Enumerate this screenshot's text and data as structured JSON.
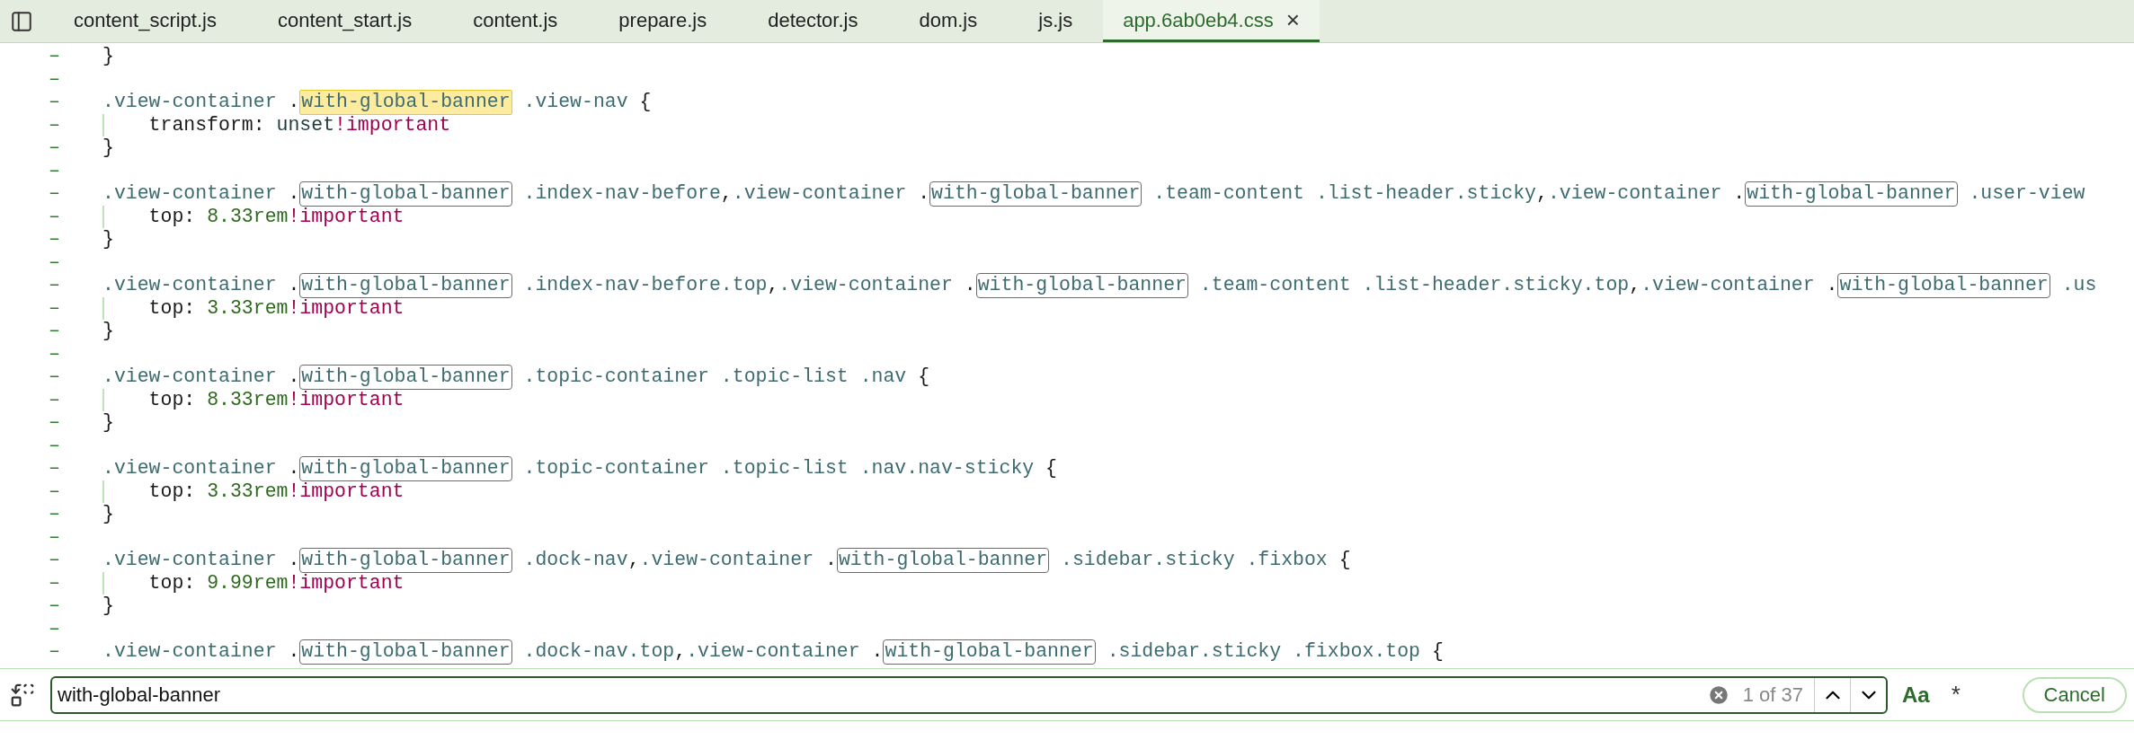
{
  "tabs": [
    {
      "label": "content_script.js",
      "selected": false
    },
    {
      "label": "content_start.js",
      "selected": false
    },
    {
      "label": "content.js",
      "selected": false
    },
    {
      "label": "prepare.js",
      "selected": false
    },
    {
      "label": "detector.js",
      "selected": false
    },
    {
      "label": "dom.js",
      "selected": false
    },
    {
      "label": "js.js",
      "selected": false
    },
    {
      "label": "app.6ab0eb4.css",
      "selected": true,
      "close": "×"
    }
  ],
  "code_lines": [
    {
      "kind": "code",
      "marker": "–",
      "tokens": [
        {
          "text": "}",
          "kind": "punct"
        }
      ]
    },
    {
      "kind": "code",
      "marker": "–"
    },
    {
      "kind": "code",
      "marker": "–",
      "tokens": [
        {
          "text": ".view-container ",
          "kind": "sel"
        },
        {
          "text": ".",
          "kind": "punct"
        },
        {
          "text": "with-global-banner",
          "kind": "current"
        },
        {
          "text": " .view-nav ",
          "kind": "sel"
        },
        {
          "text": "{",
          "kind": "punct"
        }
      ]
    },
    {
      "kind": "declaration",
      "marker": "–",
      "tokens": [
        {
          "text": "    transform: ",
          "kind": "prop"
        },
        {
          "text": "unset",
          "kind": "value"
        },
        {
          "text": "!important",
          "kind": "kw"
        }
      ]
    },
    {
      "kind": "code",
      "marker": "–",
      "tokens": [
        {
          "text": "}",
          "kind": "punct"
        }
      ]
    },
    {
      "kind": "code",
      "marker": "–"
    },
    {
      "kind": "code",
      "marker": "–",
      "tokens": [
        {
          "text": ".view-container ",
          "kind": "sel"
        },
        {
          "text": ".",
          "kind": "punct"
        },
        {
          "text": "with-global-banner",
          "kind": "match"
        },
        {
          "text": " .index-nav-before",
          "kind": "sel"
        },
        {
          "text": ",",
          "kind": "punct"
        },
        {
          "text": ".view-container ",
          "kind": "sel"
        },
        {
          "text": ".",
          "kind": "punct"
        },
        {
          "text": "with-global-banner",
          "kind": "match"
        },
        {
          "text": " .team-content .list-header.sticky",
          "kind": "sel"
        },
        {
          "text": ",",
          "kind": "punct"
        },
        {
          "text": ".view-container ",
          "kind": "sel"
        },
        {
          "text": ".",
          "kind": "punct"
        },
        {
          "text": "with-global-banner",
          "kind": "match"
        },
        {
          "text": " .user-view",
          "kind": "sel"
        }
      ]
    },
    {
      "kind": "declaration",
      "marker": "–",
      "tokens": [
        {
          "text": "    top: ",
          "kind": "prop"
        },
        {
          "text": "8.33rem",
          "kind": "num"
        },
        {
          "text": "!important",
          "kind": "kw"
        }
      ]
    },
    {
      "kind": "code",
      "marker": "–",
      "tokens": [
        {
          "text": "}",
          "kind": "punct"
        }
      ]
    },
    {
      "kind": "code",
      "marker": "–"
    },
    {
      "kind": "code",
      "marker": "–",
      "tokens": [
        {
          "text": ".view-container ",
          "kind": "sel"
        },
        {
          "text": ".",
          "kind": "punct"
        },
        {
          "text": "with-global-banner",
          "kind": "match"
        },
        {
          "text": " .index-nav-before.top",
          "kind": "sel"
        },
        {
          "text": ",",
          "kind": "punct"
        },
        {
          "text": ".view-container ",
          "kind": "sel"
        },
        {
          "text": ".",
          "kind": "punct"
        },
        {
          "text": "with-global-banner",
          "kind": "match"
        },
        {
          "text": " .team-content .list-header.sticky.top",
          "kind": "sel"
        },
        {
          "text": ",",
          "kind": "punct"
        },
        {
          "text": ".view-container ",
          "kind": "sel"
        },
        {
          "text": ".",
          "kind": "punct"
        },
        {
          "text": "with-global-banner",
          "kind": "match"
        },
        {
          "text": " .us",
          "kind": "sel"
        }
      ]
    },
    {
      "kind": "declaration",
      "marker": "–",
      "tokens": [
        {
          "text": "    top: ",
          "kind": "prop"
        },
        {
          "text": "3.33rem",
          "kind": "num"
        },
        {
          "text": "!important",
          "kind": "kw"
        }
      ]
    },
    {
      "kind": "code",
      "marker": "–",
      "tokens": [
        {
          "text": "}",
          "kind": "punct"
        }
      ]
    },
    {
      "kind": "code",
      "marker": "–"
    },
    {
      "kind": "code",
      "marker": "–",
      "tokens": [
        {
          "text": ".view-container ",
          "kind": "sel"
        },
        {
          "text": ".",
          "kind": "punct"
        },
        {
          "text": "with-global-banner",
          "kind": "match"
        },
        {
          "text": " .topic-container .topic-list .nav ",
          "kind": "sel"
        },
        {
          "text": "{",
          "kind": "punct"
        }
      ]
    },
    {
      "kind": "declaration",
      "marker": "–",
      "tokens": [
        {
          "text": "    top: ",
          "kind": "prop"
        },
        {
          "text": "8.33rem",
          "kind": "num"
        },
        {
          "text": "!important",
          "kind": "kw"
        }
      ]
    },
    {
      "kind": "code",
      "marker": "–",
      "tokens": [
        {
          "text": "}",
          "kind": "punct"
        }
      ]
    },
    {
      "kind": "code",
      "marker": "–"
    },
    {
      "kind": "code",
      "marker": "–",
      "tokens": [
        {
          "text": ".view-container ",
          "kind": "sel"
        },
        {
          "text": ".",
          "kind": "punct"
        },
        {
          "text": "with-global-banner",
          "kind": "match"
        },
        {
          "text": " .topic-container .topic-list .nav.nav-sticky ",
          "kind": "sel"
        },
        {
          "text": "{",
          "kind": "punct"
        }
      ]
    },
    {
      "kind": "declaration",
      "marker": "–",
      "tokens": [
        {
          "text": "    top: ",
          "kind": "prop"
        },
        {
          "text": "3.33rem",
          "kind": "num"
        },
        {
          "text": "!important",
          "kind": "kw"
        }
      ]
    },
    {
      "kind": "code",
      "marker": "–",
      "tokens": [
        {
          "text": "}",
          "kind": "punct"
        }
      ]
    },
    {
      "kind": "code",
      "marker": "–"
    },
    {
      "kind": "code",
      "marker": "–",
      "tokens": [
        {
          "text": ".view-container ",
          "kind": "sel"
        },
        {
          "text": ".",
          "kind": "punct"
        },
        {
          "text": "with-global-banner",
          "kind": "match"
        },
        {
          "text": " .dock-nav",
          "kind": "sel"
        },
        {
          "text": ",",
          "kind": "punct"
        },
        {
          "text": ".view-container ",
          "kind": "sel"
        },
        {
          "text": ".",
          "kind": "punct"
        },
        {
          "text": "with-global-banner",
          "kind": "match"
        },
        {
          "text": " .sidebar.sticky .fixbox ",
          "kind": "sel"
        },
        {
          "text": "{",
          "kind": "punct"
        }
      ]
    },
    {
      "kind": "declaration",
      "marker": "–",
      "tokens": [
        {
          "text": "    top: ",
          "kind": "prop"
        },
        {
          "text": "9.99rem",
          "kind": "num"
        },
        {
          "text": "!important",
          "kind": "kw"
        }
      ]
    },
    {
      "kind": "code",
      "marker": "–",
      "tokens": [
        {
          "text": "}",
          "kind": "punct"
        }
      ]
    },
    {
      "kind": "code",
      "marker": "–"
    },
    {
      "kind": "code",
      "marker": "–",
      "tokens": [
        {
          "text": ".view-container ",
          "kind": "sel"
        },
        {
          "text": ".",
          "kind": "punct"
        },
        {
          "text": "with-global-banner",
          "kind": "match"
        },
        {
          "text": " .dock-nav.top",
          "kind": "sel"
        },
        {
          "text": ",",
          "kind": "punct"
        },
        {
          "text": ".view-container ",
          "kind": "sel"
        },
        {
          "text": ".",
          "kind": "punct"
        },
        {
          "text": "with-global-banner",
          "kind": "match"
        },
        {
          "text": " .sidebar.sticky .fixbox.top ",
          "kind": "sel"
        },
        {
          "text": "{",
          "kind": "punct"
        }
      ]
    }
  ],
  "search": {
    "value": "with-global-banner",
    "count": "1 of 37",
    "match_case": "Aa",
    "regex": "*",
    "cancel": "Cancel"
  }
}
